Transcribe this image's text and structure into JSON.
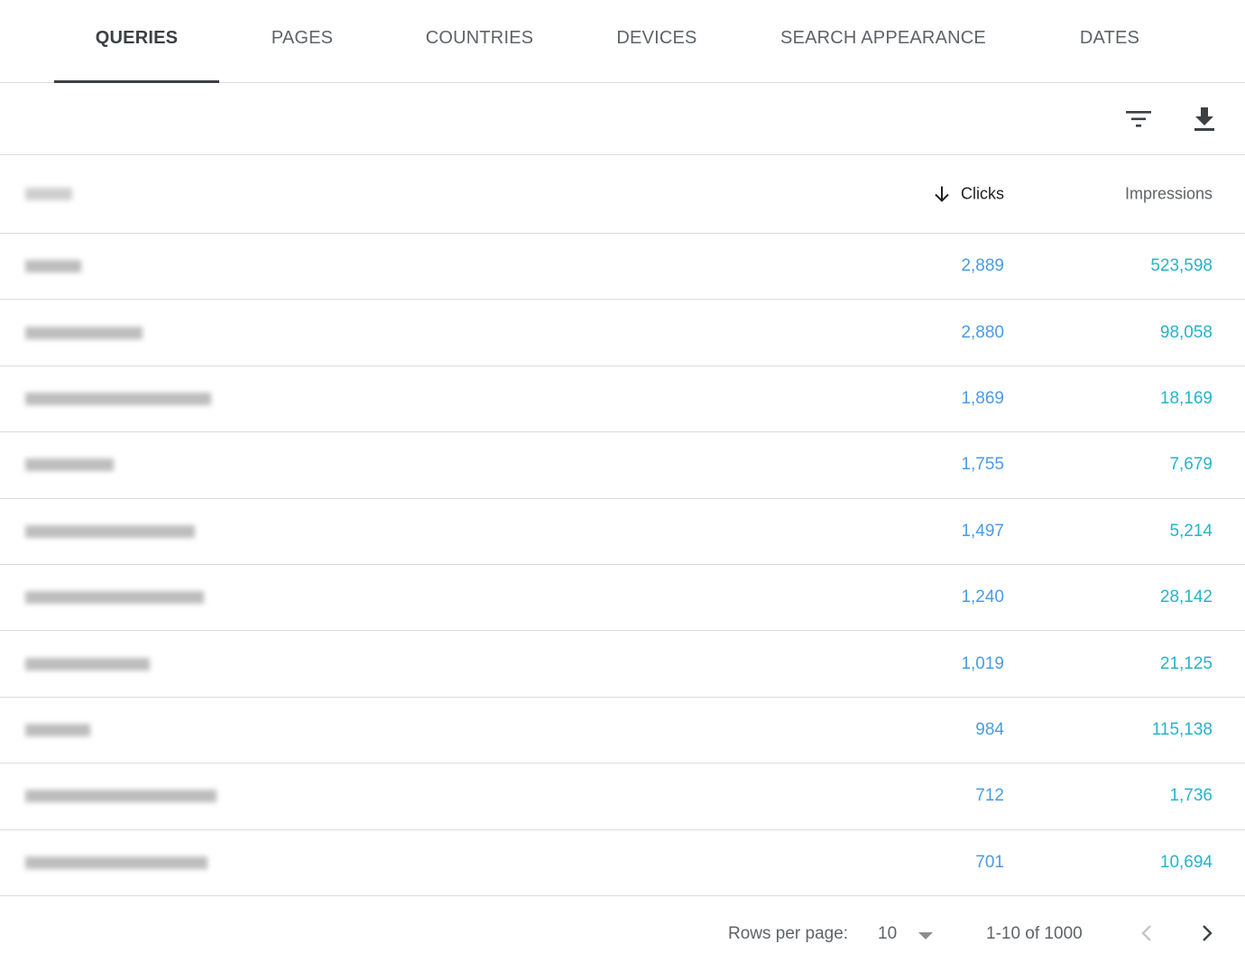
{
  "tabs": [
    {
      "label": "QUERIES",
      "active": true
    },
    {
      "label": "PAGES",
      "active": false
    },
    {
      "label": "COUNTRIES",
      "active": false
    },
    {
      "label": "DEVICES",
      "active": false
    },
    {
      "label": "SEARCH APPEARANCE",
      "active": false
    },
    {
      "label": "DATES",
      "active": false
    }
  ],
  "toolbar": {
    "filter_icon": "filter-icon",
    "download_icon": "download-icon"
  },
  "table": {
    "columns": {
      "query": "",
      "clicks": "Clicks",
      "impressions": "Impressions"
    },
    "sort": {
      "column": "clicks",
      "direction": "desc",
      "icon": "arrow-down-icon"
    },
    "rows": [
      {
        "query": "",
        "clicks": "2,889",
        "impressions": "523,598"
      },
      {
        "query": "",
        "clicks": "2,880",
        "impressions": "98,058"
      },
      {
        "query": "",
        "clicks": "1,869",
        "impressions": "18,169"
      },
      {
        "query": "",
        "clicks": "1,755",
        "impressions": "7,679"
      },
      {
        "query": "",
        "clicks": "1,497",
        "impressions": "5,214"
      },
      {
        "query": "",
        "clicks": "1,240",
        "impressions": "28,142"
      },
      {
        "query": "",
        "clicks": "1,019",
        "impressions": "21,125"
      },
      {
        "query": "",
        "clicks": "984",
        "impressions": "115,138"
      },
      {
        "query": "",
        "clicks": "712",
        "impressions": "1,736"
      },
      {
        "query": "",
        "clicks": "701",
        "impressions": "10,694"
      }
    ]
  },
  "pagination": {
    "rows_per_page_label": "Rows per page:",
    "rows_per_page_value": "10",
    "range": "1-10 of 1000",
    "prev_icon": "chevron-left-icon",
    "next_icon": "chevron-right-icon"
  },
  "colors": {
    "clicks": "#4a9be6",
    "impressions": "#26b3c9",
    "active_tab": "#3c4043"
  }
}
